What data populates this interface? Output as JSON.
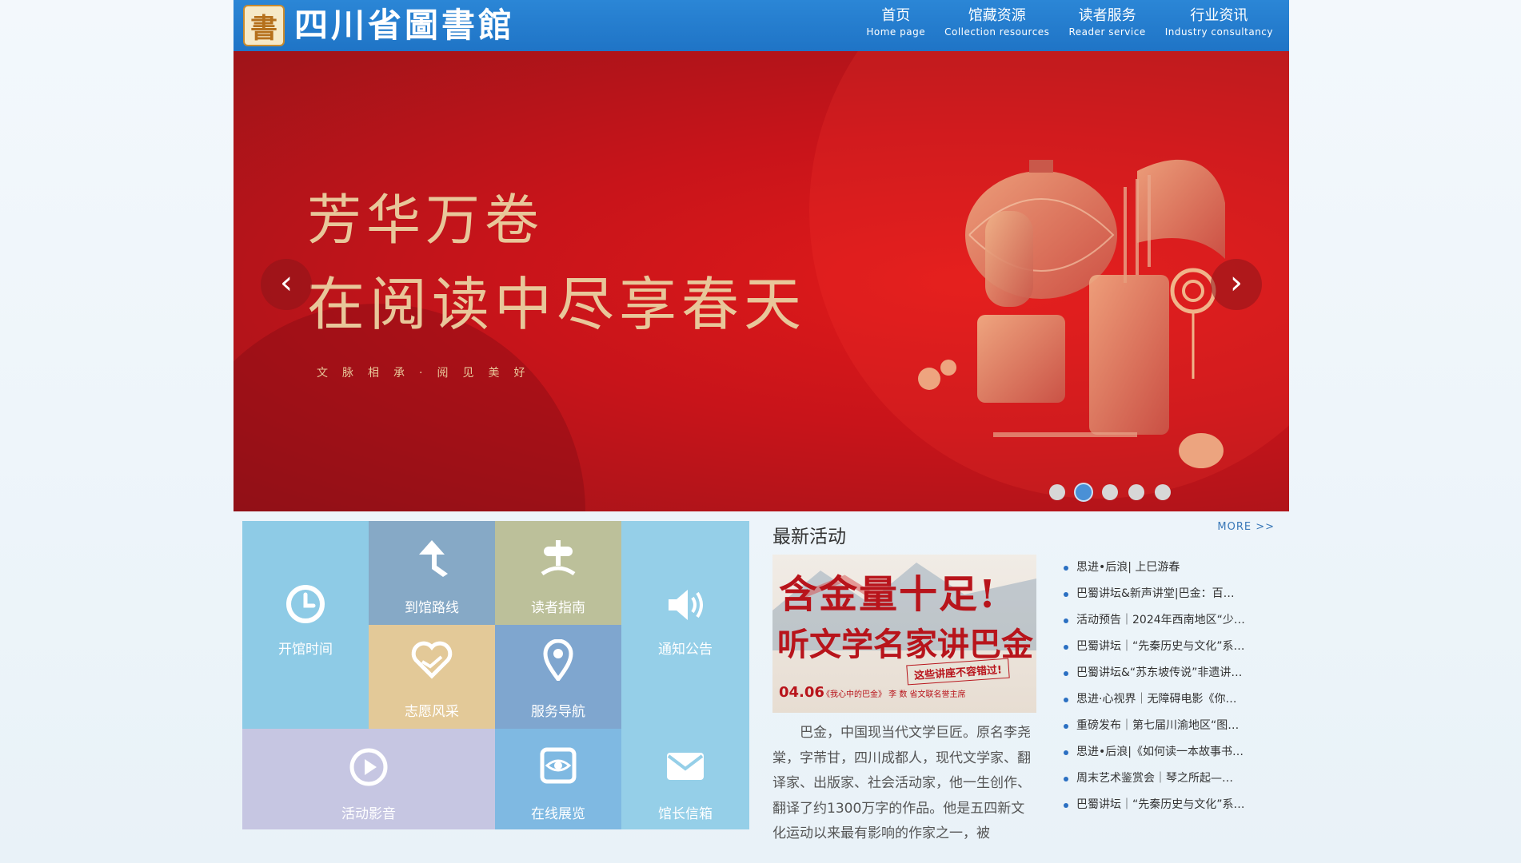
{
  "header": {
    "logo_seal": "書",
    "logo_text": "四川省圖書館",
    "nav": [
      {
        "zh": "首页",
        "en": "Home page"
      },
      {
        "zh": "馆藏资源",
        "en": "Collection resources"
      },
      {
        "zh": "读者服务",
        "en": "Reader service"
      },
      {
        "zh": "行业资讯",
        "en": "Industry consultancy"
      }
    ]
  },
  "banner": {
    "title_line1": "芳华万卷",
    "title_line2": "在阅读中尽享春天",
    "subtitle": "文脉相承·阅见美好",
    "prev": "‹",
    "next": "›",
    "slide_count": 5,
    "active_slide": 2
  },
  "tiles": [
    {
      "label": "开馆时间",
      "icon": "clock-icon"
    },
    {
      "label": "到馆路线",
      "icon": "route-arrow-icon"
    },
    {
      "label": "读者指南",
      "icon": "signpost-icon"
    },
    {
      "label": "通知公告",
      "icon": "speaker-icon"
    },
    {
      "label": "志愿风采",
      "icon": "heart-hand-icon"
    },
    {
      "label": "服务导航",
      "icon": "location-pin-icon"
    },
    {
      "label": "活动影音",
      "icon": "play-icon"
    },
    {
      "label": "在线展览",
      "icon": "eye-icon"
    },
    {
      "label": "馆长信箱",
      "icon": "mail-icon"
    }
  ],
  "tile_colors": {
    "blue_light": "#8ecbe6",
    "slate": "#86a9c6",
    "olive": "#bcc09a",
    "sand": "#e3c998",
    "steel": "#7fa6cf",
    "lavender": "#c6c6e2",
    "sky": "#7fb9e2",
    "aqua": "#95cfe8"
  },
  "activities": {
    "title": "最新活动",
    "more": "MORE >>",
    "poster": {
      "line1": "含金量十足!",
      "line2": "听文学名家讲巴金",
      "tag": "这些讲座不容错过!",
      "date": "04.06",
      "meta": "《我心中的巴金》 李 数 省文联名誉主席"
    },
    "description": "巴金，中国现当代文学巨匠。原名李尧棠，字芾甘，四川成都人，现代文学家、翻译家、出版家、社会活动家，他一生创作、翻译了约1300万字的作品。他是五四新文化运动以来最有影响的作家之一，被",
    "news": [
      "思进•后浪| 上巳游春",
      "巴蜀讲坛&新声讲堂|巴金：百…",
      "活动预告｜2024年西南地区“少…",
      "巴蜀讲坛｜“先秦历史与文化”系…",
      "巴蜀讲坛&“苏东坡传说”非遗讲…",
      "思进·心视界｜无障碍电影《你…",
      "重磅发布｜第七届川渝地区“图…",
      "思进•后浪|《如何读一本故事书…",
      "周末艺术鉴赏会｜琴之所起—…",
      "巴蜀讲坛｜“先秦历史与文化”系…"
    ]
  }
}
